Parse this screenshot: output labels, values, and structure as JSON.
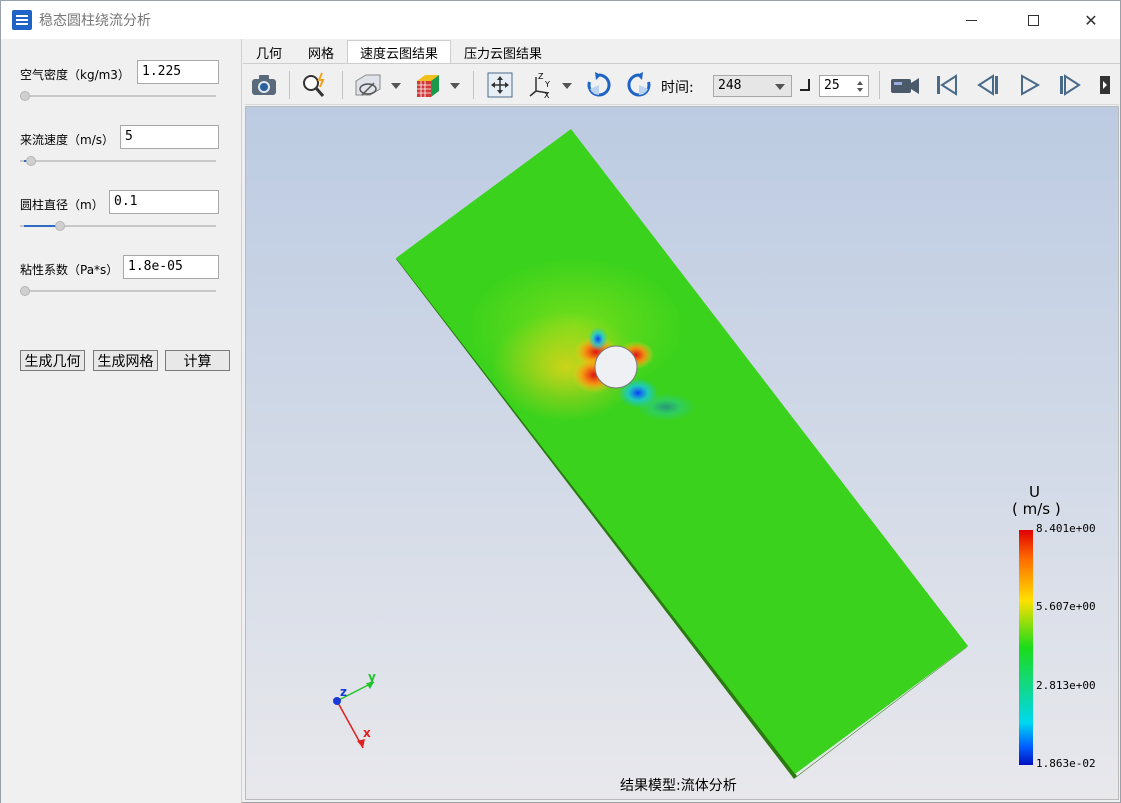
{
  "window": {
    "title": "稳态圆柱绕流分析",
    "close_glyph": "✕"
  },
  "params": [
    {
      "label": "空气密度（kg/m3）",
      "value": "1.225",
      "slider_fraction": 0.0
    },
    {
      "label": "来流速度（m/s）",
      "value": "5",
      "slider_fraction": 0.04
    },
    {
      "label": "圆柱直径（m）",
      "value": "0.1",
      "slider_fraction": 0.18
    },
    {
      "label": "粘性系数（Pa*s）",
      "value": "1.8e-05",
      "slider_fraction": 0.0
    }
  ],
  "actions": {
    "gen_geometry": "生成几何",
    "gen_mesh": "生成网格",
    "compute": "计算"
  },
  "tabs": [
    {
      "label": "几何",
      "active": false
    },
    {
      "label": "网格",
      "active": false
    },
    {
      "label": "速度云图结果",
      "active": true
    },
    {
      "label": "压力云图结果",
      "active": false
    }
  ],
  "toolbar": {
    "time_label": "时间:",
    "time_value": "248",
    "step_value": "25"
  },
  "colorbar": {
    "variable": "U",
    "unit": "( m/s )",
    "ticks": [
      "8.401e+00",
      "5.607e+00",
      "2.813e+00",
      "1.863e-02"
    ],
    "max": 8.401,
    "min": 0.01863
  },
  "axes_triad": {
    "x": "x",
    "y": "y",
    "z": "z"
  },
  "status": "结果模型:流体分析",
  "colors": {
    "accent": "#2d6cc0",
    "field_green": "#3ad21c"
  }
}
